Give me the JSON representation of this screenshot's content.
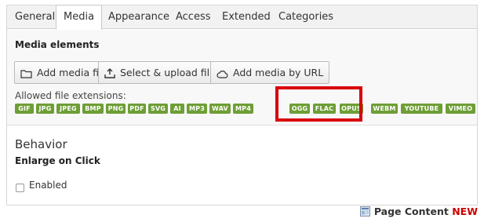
{
  "tabs": [
    {
      "label": "General"
    },
    {
      "label": "Media",
      "active": true
    },
    {
      "label": "Appearance"
    },
    {
      "label": "Access"
    },
    {
      "label": "Extended"
    },
    {
      "label": "Categories"
    }
  ],
  "media": {
    "title": "Media elements",
    "buttons": {
      "add_file": "Add media file",
      "select_upload": "Select & upload files",
      "add_url": "Add media by URL"
    },
    "extensions_label": "Allowed file extensions:",
    "extensions": [
      "GIF",
      "JPG",
      "JPEG",
      "BMP",
      "PNG",
      "PDF",
      "SVG",
      "AI",
      "MP3",
      "WAV",
      "MP4",
      "OGG",
      "FLAC",
      "OPUS",
      "WEBM",
      "YOUTUBE",
      "VIMEO"
    ],
    "highlighted_extensions": [
      "OGG",
      "FLAC",
      "OPUS"
    ],
    "badge_color": "#6e9e36",
    "highlight_color": "#d8000c"
  },
  "behavior": {
    "title": "Behavior",
    "subtitle": "Enlarge on Click",
    "checkbox_label": "Enabled",
    "checked": false
  },
  "footer": {
    "label": "Page Content",
    "badge": "NEW"
  }
}
